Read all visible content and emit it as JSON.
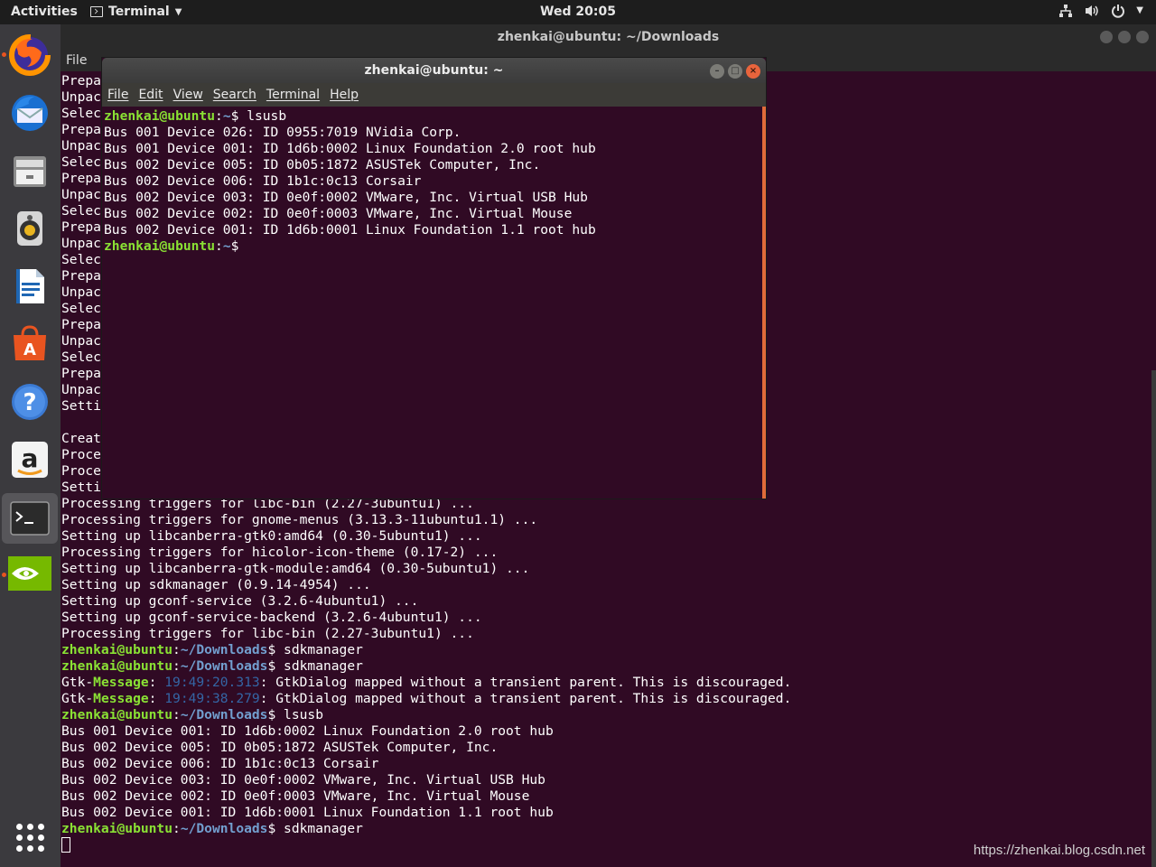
{
  "topbar": {
    "activities": "Activities",
    "app_name": "Terminal",
    "clock": "Wed 20:05"
  },
  "dock": {
    "items": [
      "firefox-icon",
      "thunderbird-icon",
      "files-icon",
      "rhythmbox-icon",
      "writer-icon",
      "software-icon",
      "help-icon",
      "amazon-icon",
      "terminal-icon",
      "nvidia-icon"
    ],
    "apps_icon": "show-applications-icon"
  },
  "bg_window": {
    "title": "zhenkai@ubuntu: ~/Downloads",
    "menu": [
      "File",
      "Edit",
      "View",
      "Search",
      "Terminal",
      "Help"
    ],
    "left_fragments": [
      "Prepa",
      "Unpac",
      "Selec",
      "Prepa",
      "Unpac",
      "Selec",
      "Prepa",
      "Unpac",
      "Selec",
      "Prepa",
      "Unpac",
      "Selec",
      "Prepa",
      "Unpac",
      "Selec",
      "Prepa",
      "Unpac",
      "Selec",
      "Prepa",
      "Unpac",
      "Setti",
      "",
      "Creat",
      "Proce",
      "Proce",
      "Setti"
    ],
    "lines": [
      "Processing triggers for libc-bin (2.27-3ubuntu1) ...",
      "Processing triggers for gnome-menus (3.13.3-11ubuntu1.1) ...",
      "Setting up libcanberra-gtk0:amd64 (0.30-5ubuntu1) ...",
      "Processing triggers for hicolor-icon-theme (0.17-2) ...",
      "Setting up libcanberra-gtk-module:amd64 (0.30-5ubuntu1) ...",
      "Setting up sdkmanager (0.9.14-4954) ...",
      "Setting up gconf-service (3.2.6-4ubuntu1) ...",
      "Setting up gconf-service-backend (3.2.6-4ubuntu1) ...",
      "Processing triggers for libc-bin (2.27-3ubuntu1) ..."
    ],
    "prompt_user": "zhenkai@ubuntu",
    "prompt_path": "~/Downloads",
    "cmd1": "sdkmanager",
    "cmd2": "sdkmanager",
    "gtk1_label": "Gtk-",
    "gtk1_word": "Message",
    "gtk1_time": "19:49:20.313",
    "gtk1_text": "GtkDialog mapped without a transient parent. This is discouraged.",
    "gtk2_label": "Gtk-",
    "gtk2_word": "Message",
    "gtk2_time": "19:49:38.279",
    "gtk2_text": "GtkDialog mapped without a transient parent. This is discouraged.",
    "cmd3": "lsusb",
    "usb_lines": [
      "Bus 001 Device 001: ID 1d6b:0002 Linux Foundation 2.0 root hub",
      "Bus 002 Device 005: ID 0b05:1872 ASUSTek Computer, Inc.",
      "Bus 002 Device 006: ID 1b1c:0c13 Corsair",
      "Bus 002 Device 003: ID 0e0f:0002 VMware, Inc. Virtual USB Hub",
      "Bus 002 Device 002: ID 0e0f:0003 VMware, Inc. Virtual Mouse",
      "Bus 002 Device 001: ID 1d6b:0001 Linux Foundation 1.1 root hub"
    ],
    "cmd4": "sdkmanager"
  },
  "fg_window": {
    "title": "zhenkai@ubuntu: ~",
    "menu": [
      "File",
      "Edit",
      "View",
      "Search",
      "Terminal",
      "Help"
    ],
    "prompt_user": "zhenkai@ubuntu",
    "prompt_path": "~",
    "cmd": "lsusb",
    "usb_lines": [
      "Bus 001 Device 026: ID 0955:7019 NVidia Corp.",
      "Bus 001 Device 001: ID 1d6b:0002 Linux Foundation 2.0 root hub",
      "Bus 002 Device 005: ID 0b05:1872 ASUSTek Computer, Inc.",
      "Bus 002 Device 006: ID 1b1c:0c13 Corsair",
      "Bus 002 Device 003: ID 0e0f:0002 VMware, Inc. Virtual USB Hub",
      "Bus 002 Device 002: ID 0e0f:0003 VMware, Inc. Virtual Mouse",
      "Bus 002 Device 001: ID 1d6b:0001 Linux Foundation 1.1 root hub"
    ]
  },
  "watermark": "https://zhenkai.blog.csdn.net"
}
